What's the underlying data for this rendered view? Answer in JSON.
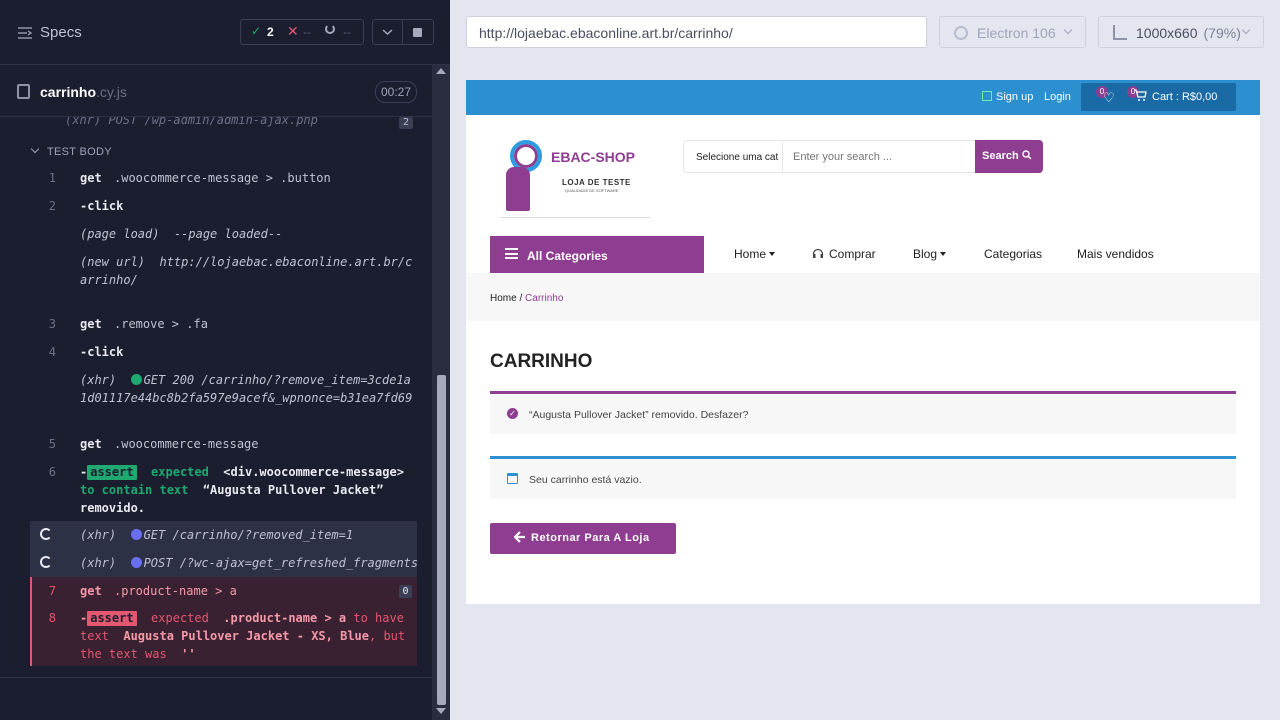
{
  "runner": {
    "specs_title": "Specs",
    "stats": {
      "passed": "2",
      "failed": "--",
      "pending": "--"
    },
    "file": {
      "name": "carrinho",
      "ext": ".cy.js",
      "time": "00:27"
    },
    "partial_cmd": {
      "text": "(xhr)  POST /wp-admin/admin-ajax.php",
      "count": "2"
    },
    "test_body_label": "TEST BODY",
    "commands": [
      {
        "num": "1",
        "name": "get",
        "message": ".woocommerce-message > .button"
      },
      {
        "num": "2",
        "name": "-click"
      },
      {
        "event": "(page load)",
        "message": "--page loaded--"
      },
      {
        "event": "(new url)",
        "message": "http://lojaebac.ebaconline.art.br/carrinho/"
      },
      {
        "num": "3",
        "name": "get",
        "message": ".remove > .fa"
      },
      {
        "num": "4",
        "name": "-click"
      },
      {
        "event": "(xhr)",
        "message": "GET 200 /carrinho/?remove_item=3cde1a1d01117e44bc8b2fa597e9acef&_wpnonce=b31ea7fd69"
      },
      {
        "num": "5",
        "name": "get",
        "message": ".woocommerce-message"
      },
      {
        "num": "6",
        "assert": "assert",
        "expected": "expected",
        "subject": "<div.woocommerce-message>",
        "verb": "to contain text",
        "value": "“Augusta Pullover Jacket” removido."
      },
      {
        "event": "(xhr)",
        "message": "GET /carrinho/?removed_item=1"
      },
      {
        "event": "(xhr)",
        "message": "POST /?wc-ajax=get_refreshed_fragments"
      },
      {
        "num": "7",
        "name": "get",
        "message": ".product-name > a",
        "count": "0"
      },
      {
        "num": "8",
        "assert": "assert",
        "expected": "expected",
        "subject": ".product-name > a",
        "verb": "to have text",
        "value": "Augusta Pullover Jacket - XS, Blue",
        "but": ", but the text was",
        "actual": "''"
      }
    ]
  },
  "browser": {
    "url": "http://lojaebac.ebaconline.art.br/carrinho/",
    "engine": "Electron 106",
    "viewport": "1000x660",
    "zoom": "(79%)"
  },
  "site": {
    "signup": "Sign up",
    "login": "Login",
    "wishlist_count": "0",
    "cart_count": "0",
    "cart_label": "Cart : R$0,00",
    "logo_name": "EBAC-SHOP",
    "logo_sub": "LOJA DE TESTE",
    "logo_sub2": "QUALIDADE DE SOFTWARE",
    "search_category": "Selecione uma cat",
    "search_placeholder": "Enter your search ...",
    "search_button": "Search",
    "all_categories": "All Categories",
    "nav": [
      "Home",
      "Comprar",
      "Blog",
      "Categorias",
      "Mais vendidos"
    ],
    "breadcrumb_home": "Home",
    "breadcrumb_current": "Carrinho",
    "page_title": "CARRINHO",
    "notice_message": "“Augusta Pullover Jacket” removido. Desfazer?",
    "notice_info": "Seu carrinho está vazio.",
    "return_button": "Retornar Para A Loja"
  },
  "colors": {
    "brand_purple": "#8e3d91",
    "topbar_blue": "#2b8fd0",
    "pass_green": "#1fa971",
    "fail_red": "#e45770"
  }
}
